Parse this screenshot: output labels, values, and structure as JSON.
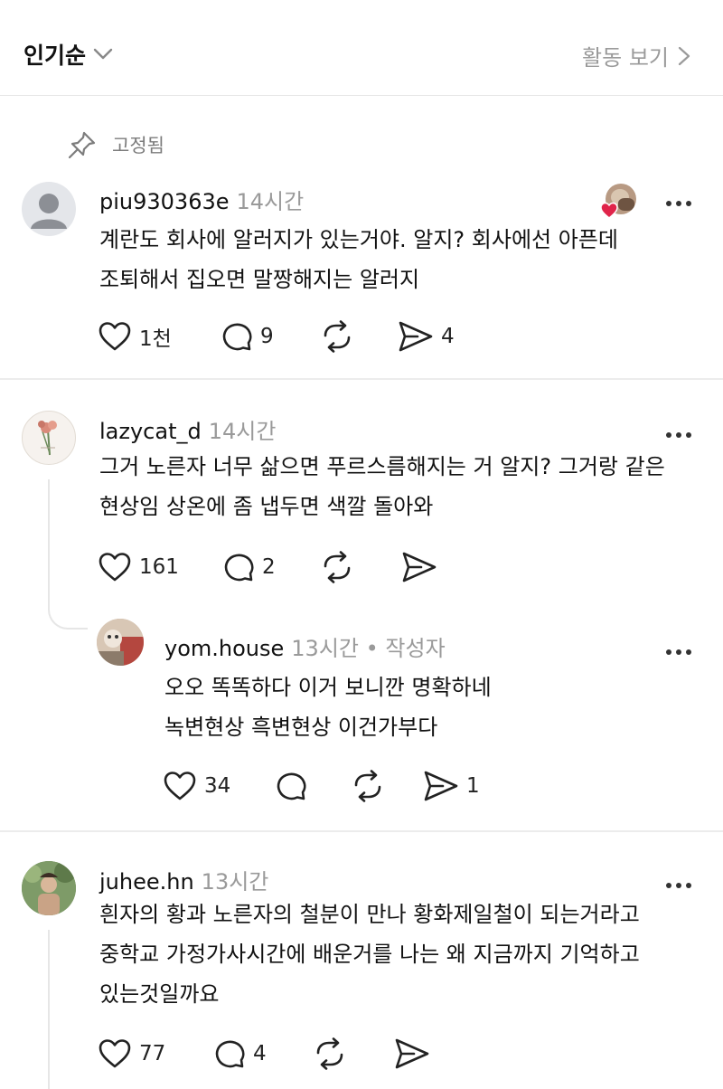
{
  "header": {
    "sort_label": "인기순",
    "activity_label": "활동 보기"
  },
  "pinned": {
    "label": "고정됨"
  },
  "comments": [
    {
      "username": "piu930363e",
      "time": "14시간",
      "text_lines": [
        "계란도 회사에 알러지가 있는거야. 알지? 회사에선 아픈데",
        "조퇴해서 집오면 말짱해지는 알러지"
      ],
      "likes": "1천",
      "replies": "9",
      "reposts": "",
      "shares": "4",
      "liked_by_author": true
    },
    {
      "username": "lazycat_d",
      "time": "14시간",
      "text_lines": [
        "그거 노른자 너무 삶으면 푸르스름해지는 거  알지? 그거랑 같은",
        "현상임 상온에 좀 냅두면 색깔 돌아와"
      ],
      "likes": "161",
      "replies": "2",
      "reposts": "",
      "shares": ""
    },
    {
      "username": "yom.house",
      "time": "13시간",
      "badge": "• 작성자",
      "text_lines": [
        "오오 똑똑하다 이거 보니깐 명확하네",
        "녹변현상 흑변현상 이건가부다"
      ],
      "likes": "34",
      "replies": "",
      "reposts": "",
      "shares": "1"
    },
    {
      "username": "juhee.hn",
      "time": "13시간",
      "text_lines": [
        "흰자의 황과 노른자의 철분이 만나 황화제일철이 되는거라고",
        "중학교 가정가사시간에 배운거를 나는 왜 지금까지 기억하고",
        "있는것일까요"
      ],
      "likes": "77",
      "replies": "4",
      "reposts": "",
      "shares": ""
    }
  ],
  "icons": {
    "sort": "chevron-down-icon",
    "activity": "chevron-right-icon",
    "pin": "pin-icon",
    "like": "heart-icon",
    "reply": "comment-icon",
    "repost": "repost-icon",
    "share": "send-icon",
    "more": "more-icon"
  },
  "colors": {
    "text": "#111111",
    "muted": "#9a9a9a",
    "divider": "#ececec",
    "heart_badge": "#e0244a"
  }
}
